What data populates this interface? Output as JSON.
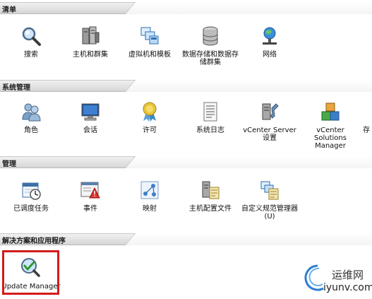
{
  "sections": {
    "inventory": {
      "title": "清单"
    },
    "system_admin": {
      "title": "系统管理"
    },
    "management": {
      "title": "管理"
    },
    "solutions": {
      "title": "解决方案和应用程序"
    }
  },
  "inventory_items": [
    {
      "label": "搜索",
      "icon": "search-icon"
    },
    {
      "label": "主机和群集",
      "icon": "hosts-clusters-icon"
    },
    {
      "label": "虚拟机和模板",
      "icon": "vms-templates-icon"
    },
    {
      "label": "数据存储和数据存储群集",
      "icon": "datastore-icon"
    },
    {
      "label": "网络",
      "icon": "network-icon"
    }
  ],
  "system_admin_items": [
    {
      "label": "角色",
      "icon": "roles-icon"
    },
    {
      "label": "会话",
      "icon": "sessions-icon"
    },
    {
      "label": "许可",
      "icon": "licensing-icon"
    },
    {
      "label": "系统日志",
      "icon": "system-logs-icon"
    },
    {
      "label": "vCenter Server 设置",
      "icon": "vcenter-settings-icon"
    },
    {
      "label": "vCenter Solutions Manager",
      "icon": "solutions-manager-icon"
    },
    {
      "label": "存",
      "icon": "storage-icon"
    }
  ],
  "management_items": [
    {
      "label": "已调度任务",
      "icon": "scheduled-tasks-icon"
    },
    {
      "label": "事件",
      "icon": "events-icon"
    },
    {
      "label": "映射",
      "icon": "maps-icon"
    },
    {
      "label": "主机配置文件",
      "icon": "host-profiles-icon"
    },
    {
      "label": "自定义规范管理器(U)",
      "icon": "customization-spec-icon"
    }
  ],
  "solutions_items": [
    {
      "label": "Update Manager",
      "icon": "update-manager-icon"
    }
  ],
  "highlight": {
    "color": "#d31b1b",
    "target": "Update Manager"
  },
  "watermark": {
    "cn": "运维网",
    "en": "iyunv.com"
  },
  "colors": {
    "header_bg": "#dcdcdc",
    "highlight": "#d31b1b"
  }
}
